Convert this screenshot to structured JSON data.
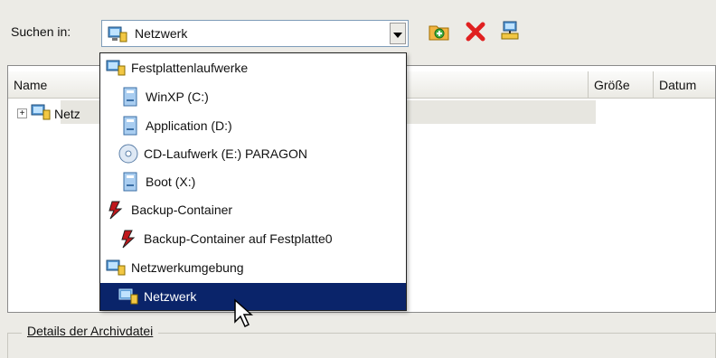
{
  "toolbar": {
    "look_in_label": "Suchen in:",
    "combo_value": "Netzwerk"
  },
  "columns": {
    "name": "Name",
    "size": "Größe",
    "date": "Datum"
  },
  "tree": {
    "expander": "+",
    "node_label": "Netz"
  },
  "dropdown": {
    "items": [
      {
        "label": "Festplattenlaufwerke",
        "icon": "network-computer-icon"
      },
      {
        "label": "WinXP (C:)",
        "icon": "drive-icon"
      },
      {
        "label": "Application (D:)",
        "icon": "drive-icon"
      },
      {
        "label": "CD-Laufwerk (E:) PARAGON",
        "icon": "cd-drive-icon"
      },
      {
        "label": "Boot (X:)",
        "icon": "drive-icon"
      },
      {
        "label": "Backup-Container",
        "icon": "backup-icon"
      },
      {
        "label": "Backup-Container auf Festplatte0",
        "icon": "backup-icon"
      },
      {
        "label": "Netzwerkumgebung",
        "icon": "network-computer-icon"
      },
      {
        "label": "Netzwerk",
        "icon": "network-computer-icon",
        "selected": true
      }
    ]
  },
  "details": {
    "group_label": "Details der Archivdatei"
  },
  "colors": {
    "selection": "#0a246a",
    "dialog_bg": "#ecebe6"
  }
}
